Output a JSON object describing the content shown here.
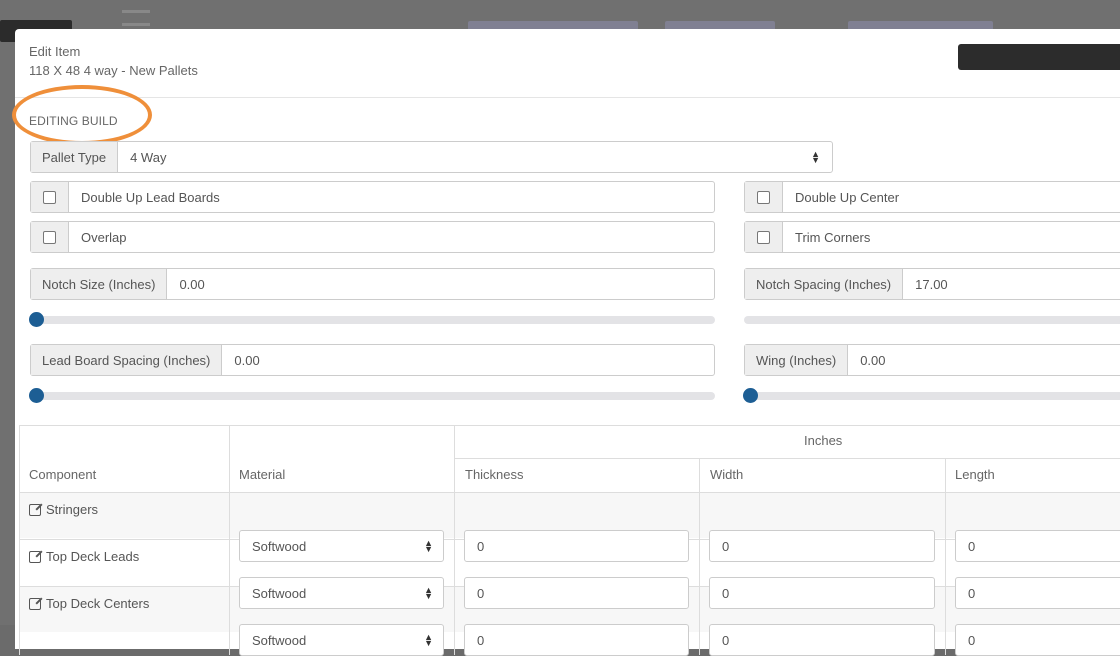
{
  "modal": {
    "title": "Edit Item",
    "subtitle": "118 X 48 4 way - New Pallets"
  },
  "section_label": "EDITING BUILD",
  "pallet_type": {
    "label": "Pallet Type",
    "value": "4 Way"
  },
  "checkboxes": {
    "double_up_lead_boards": {
      "label": "Double Up Lead Boards",
      "checked": false
    },
    "double_up_center": {
      "label": "Double Up Center",
      "checked": false
    },
    "overlap": {
      "label": "Overlap",
      "checked": false
    },
    "trim_corners": {
      "label": "Trim Corners",
      "checked": false
    }
  },
  "fields": {
    "notch_size": {
      "label": "Notch Size (Inches)",
      "value": "0.00",
      "slider_fraction": 0
    },
    "notch_spacing": {
      "label": "Notch Spacing (Inches)",
      "value": "17.00"
    },
    "lead_board_spacing": {
      "label": "Lead Board Spacing (Inches)",
      "value": "0.00",
      "slider_fraction": 0
    },
    "wing": {
      "label": "Wing (Inches)",
      "value": "0.00",
      "slider_fraction": 0
    }
  },
  "table": {
    "group_header": "Inches",
    "columns": [
      "Component",
      "Material",
      "Thickness",
      "Width",
      "Length"
    ],
    "rows": [
      {
        "component": "Stringers",
        "material": "Softwood",
        "thickness": "0",
        "width": "0",
        "length": "0"
      },
      {
        "component": "Top Deck Leads",
        "material": "Softwood",
        "thickness": "0",
        "width": "0",
        "length": "0"
      },
      {
        "component": "Top Deck Centers",
        "material": "Softwood",
        "thickness": "0",
        "width": "0",
        "length": "0"
      }
    ]
  },
  "colors": {
    "highlight": "#ef8f3a",
    "slider_knob": "#1d5e94",
    "header_button": "#2c2c2c"
  }
}
